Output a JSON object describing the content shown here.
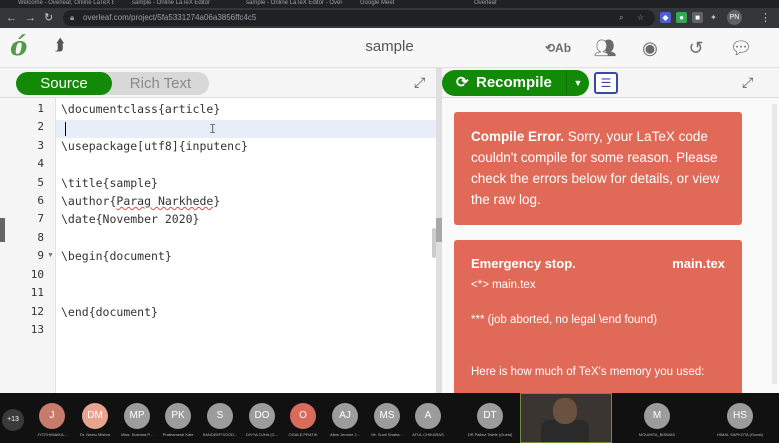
{
  "browser": {
    "tabs": [
      {
        "label": "Welcome - Overleaf, Online LaTeX Editor"
      },
      {
        "label": "sample - Online LaTeX Editor"
      },
      {
        "label": "sample - Online LaTeX Editor - Overleaf"
      },
      {
        "label": "Google Meet"
      },
      {
        "label": "Overleaf"
      }
    ],
    "url": "overleaf.com/project/5fa5331274a06a3856ffc4c5",
    "profile_initials": "PN"
  },
  "header": {
    "project_title": "sample",
    "icons": [
      "logo-icon",
      "home-icon",
      "review-icon",
      "share-icon",
      "submit-icon",
      "history-icon",
      "chat-icon"
    ]
  },
  "editor": {
    "toggle": {
      "source": "Source",
      "rich_text": "Rich Text"
    },
    "lines": [
      {
        "n": "1",
        "cmd": "\\documentclass",
        "arg": "{article}"
      },
      {
        "n": "2",
        "cmd": "",
        "arg": ""
      },
      {
        "n": "3",
        "cmd": "\\usepackage",
        "arg": "[utf8]{inputenc}"
      },
      {
        "n": "4",
        "cmd": "",
        "arg": ""
      },
      {
        "n": "5",
        "cmd": "\\title",
        "arg": "{sample}"
      },
      {
        "n": "6",
        "cmd": "\\author",
        "arg_prefix": "{",
        "arg_misspelled": "Parag Narkhede",
        "arg_suffix": "}"
      },
      {
        "n": "7",
        "cmd": "\\date",
        "arg": "{November 2020}"
      },
      {
        "n": "8",
        "cmd": "",
        "arg": ""
      },
      {
        "n": "9",
        "cmd": "\\begin",
        "arg": "{document}"
      },
      {
        "n": "10",
        "cmd": "",
        "arg": ""
      },
      {
        "n": "11",
        "cmd": "",
        "arg": ""
      },
      {
        "n": "12",
        "cmd": "\\end",
        "arg": "{document}"
      },
      {
        "n": "13",
        "cmd": "",
        "arg": ""
      }
    ]
  },
  "pdf": {
    "recompile_label": "Recompile",
    "alert1": {
      "title": "Compile Error.",
      "body": " Sorry, your LaTeX code couldn't compile for some reason. Please check the errors below for details, or view the raw log."
    },
    "alert2": {
      "title": "Emergency stop.",
      "file": "main.tex",
      "line1": "<*> main.tex",
      "line2": "*** (job aborted, no legal \\end found)",
      "line3": "Here is how much of TeX's memory you used:"
    }
  },
  "meeting": {
    "more_count": "+13",
    "participants": [
      {
        "initials": "J",
        "name": "JYOTHIMAIKA...",
        "color": "#c77b6b"
      },
      {
        "initials": "DM",
        "name": "Dr. Neetu Mishra",
        "color": "#e8a48e"
      },
      {
        "initials": "MP",
        "name": "Miss. Sushma P...",
        "color": "#9c9c9c"
      },
      {
        "initials": "PK",
        "name": "Prathamesh Kale",
        "color": "#9c9c9c"
      },
      {
        "initials": "S",
        "name": "SANDEEP.SOOD...",
        "color": "#9c9c9c"
      },
      {
        "initials": "DO",
        "name": "DIVYA OJHA (G...",
        "color": "#9c9c9c"
      },
      {
        "initials": "O",
        "name": "OGALE.PRATIK",
        "color": "#d96b5a"
      },
      {
        "initials": "AJ",
        "name": "Albin Jerome J...",
        "color": "#9c9c9c"
      },
      {
        "initials": "MS",
        "name": "Mr. Sunil Shaha...",
        "color": "#9c9c9c"
      },
      {
        "initials": "A",
        "name": "ATUL.CHIKARAS",
        "color": "#9c9c9c"
      },
      {
        "initials": "DT",
        "name": "DR Pallavi Talele (Guest)",
        "color": "#9c9c9c"
      },
      {
        "initials": "M",
        "name": "MOUMITA_BISWAS",
        "color": "#9c9c9c"
      },
      {
        "initials": "HS",
        "name": "HIMAL SAPKOTA (Guest)",
        "color": "#9c9c9c"
      }
    ]
  }
}
